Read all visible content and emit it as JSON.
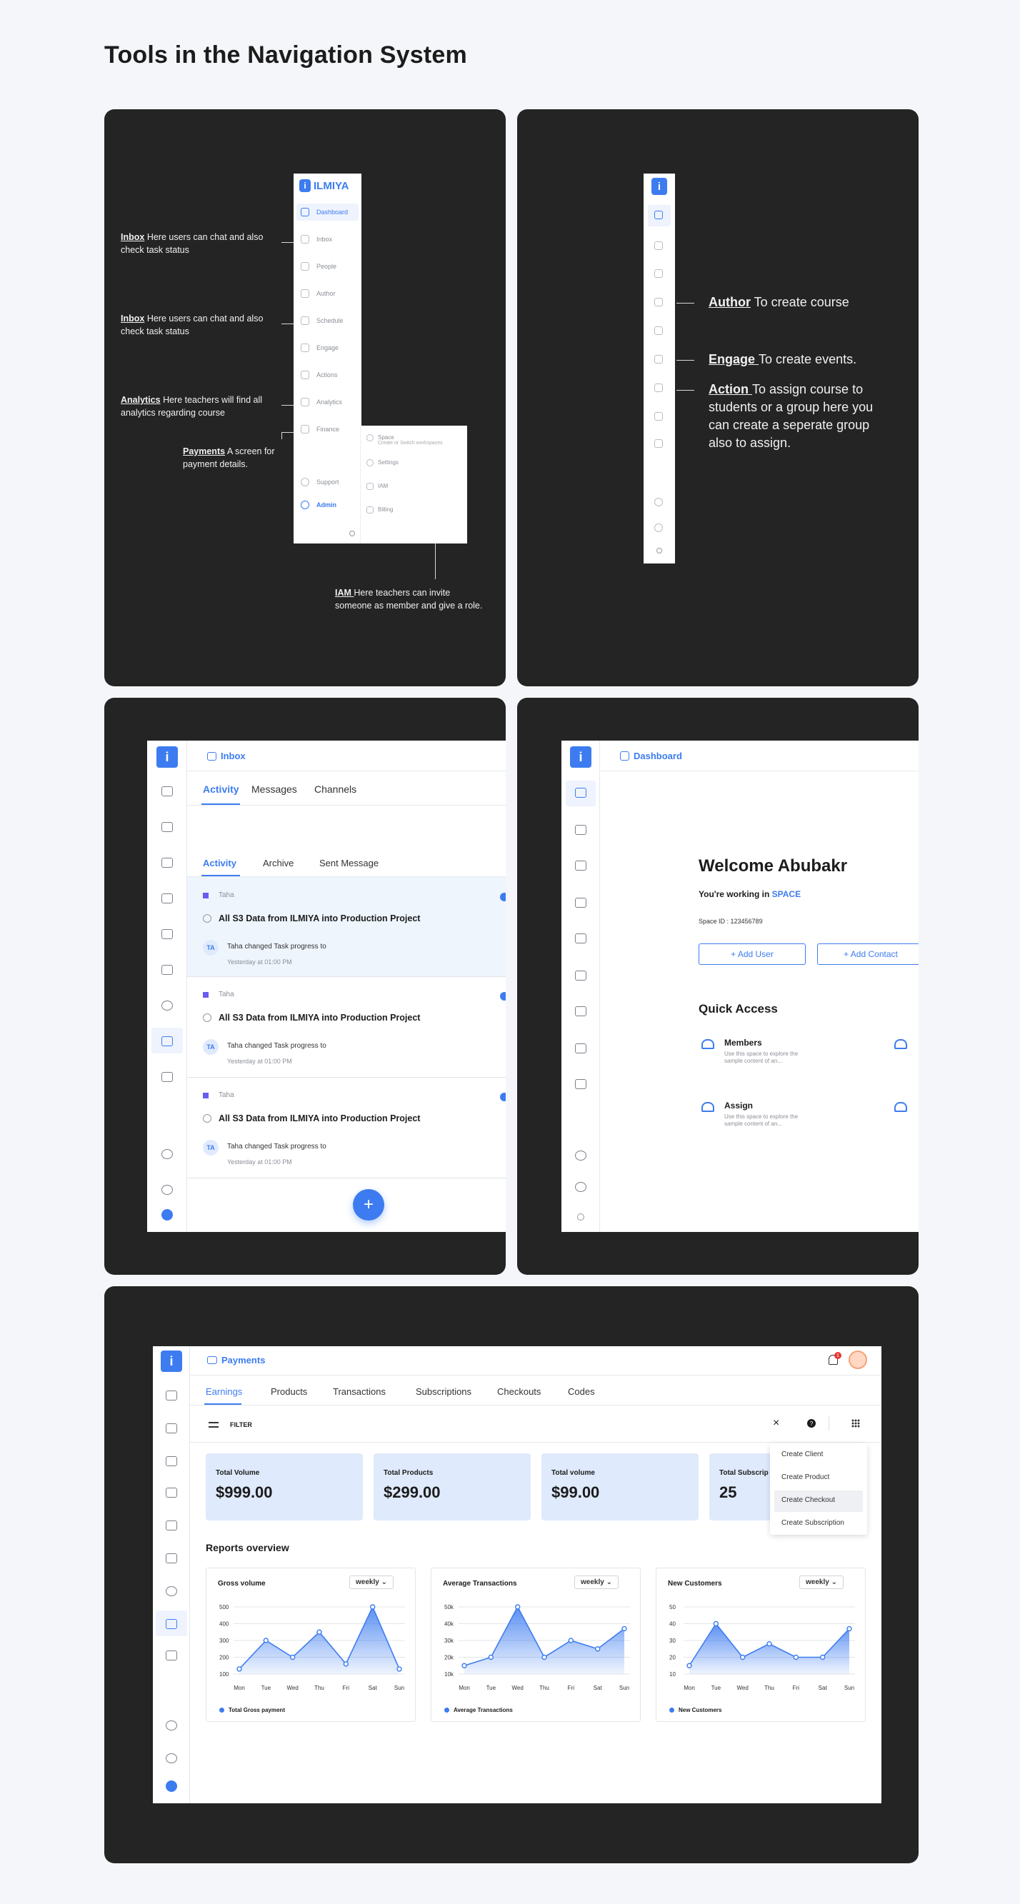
{
  "page": {
    "title": "Tools in the Navigation System"
  },
  "panel1": {
    "logo_text": "ILMIYA",
    "logo_letter": "i",
    "menu": [
      "Dashboard",
      "Inbox",
      "People",
      "Author",
      "Schedule",
      "Engage",
      "Actions",
      "Analytics",
      "Finance",
      "Support",
      "Admin"
    ],
    "submenu": [
      {
        "label": "Space",
        "sub": "Create or Switch workspaces"
      },
      {
        "label": "Settings",
        "sub": ""
      },
      {
        "label": "IAM",
        "sub": ""
      },
      {
        "label": "Billing",
        "sub": ""
      }
    ],
    "annotations": [
      {
        "key": "Inbox",
        "text": " Here users can chat and also check task status"
      },
      {
        "key": "Inbox",
        "text": " Here users can chat and also check task status"
      },
      {
        "key": "Analytics",
        "text": " Here teachers will find all analytics regarding course"
      },
      {
        "key": "Payments",
        "text": " A screen for payment details."
      },
      {
        "key": "IAM ",
        "text": " Here teachers can invite someone as member and give a role."
      }
    ]
  },
  "panel2": {
    "annotations": [
      {
        "key": "Author",
        "text": " To create course"
      },
      {
        "key": "Engage ",
        "text": "To create events."
      },
      {
        "key": "Action ",
        "text": "To assign course to students or a group here you can create a seperate group also to assign."
      }
    ]
  },
  "inbox": {
    "header": "Inbox",
    "tabs": [
      "Activity",
      "Messages",
      "Channels"
    ],
    "subtabs": [
      "Activity",
      "Archive",
      "Sent Message"
    ],
    "items": [
      {
        "author": "Taha",
        "title": "All S3 Data from ILMIYA into Production Project",
        "initials": "TA",
        "change": "Taha changed Task progress to",
        "time": "Yesterday at 01:00 PM"
      },
      {
        "author": "Taha",
        "title": "All S3 Data from ILMIYA into Production Project",
        "initials": "TA",
        "change": "Taha changed Task progress to",
        "time": "Yesterday at 01:00 PM"
      },
      {
        "author": "Taha",
        "title": "All S3 Data from ILMIYA into Production Project",
        "initials": "TA",
        "change": "Taha changed Task progress to",
        "time": "Yesterday at 01:00 PM"
      }
    ],
    "fab": "+"
  },
  "dashboard": {
    "header": "Dashboard",
    "welcome": "Welcome Abubakr",
    "working_prefix": "You're working in ",
    "space": "SPACE",
    "space_id": "Space ID : 123456789",
    "add_user": "+ Add User",
    "add_contact": "+ Add Contact",
    "quick_access": "Quick Access",
    "qa_items": [
      {
        "title": "Members",
        "desc": "Use this space to explore the sample content of an..."
      },
      {
        "title": "Assign",
        "desc": "Use this space to explore the sample content of an..."
      }
    ]
  },
  "payments": {
    "header": "Payments",
    "notif_count": "1",
    "tabs": [
      "Earnings",
      "Products",
      "Transactions",
      "Subscriptions",
      "Checkouts",
      "Codes"
    ],
    "filter": "FILTER",
    "close": "×",
    "help": "?",
    "menu": [
      "Create Client",
      "Create Product",
      "Create Checkout",
      "Create Subscription"
    ],
    "stats": [
      {
        "label": "Total Volume",
        "value": "$999.00"
      },
      {
        "label": "Total Products",
        "value": "$299.00"
      },
      {
        "label": "Total volume",
        "value": "$99.00"
      },
      {
        "label": "Total Subscrip",
        "value": "25"
      }
    ],
    "reports_title": "Reports overview",
    "period": "weekly"
  },
  "chart_data": [
    {
      "type": "area",
      "title": "Gross volume",
      "categories": [
        "Mon",
        "Tue",
        "Wed",
        "Thu",
        "Fri",
        "Sat",
        "Sun"
      ],
      "yticks": [
        "500",
        "400",
        "300",
        "200",
        "100"
      ],
      "ylim": [
        100,
        500
      ],
      "series": [
        {
          "name": "Total Gross payment",
          "values": [
            130,
            300,
            200,
            350,
            160,
            500,
            130
          ]
        }
      ],
      "color": "#3d7cf0"
    },
    {
      "type": "area",
      "title": "Average Transactions",
      "categories": [
        "Mon",
        "Tue",
        "Wed",
        "Thu",
        "Fri",
        "Sat",
        "Sun"
      ],
      "yticks": [
        "50k",
        "40k",
        "30k",
        "20k",
        "10k"
      ],
      "ylim": [
        10,
        50
      ],
      "series": [
        {
          "name": "Average Transactions",
          "values": [
            15,
            20,
            50,
            20,
            30,
            25,
            37
          ]
        }
      ],
      "color": "#3d7cf0"
    },
    {
      "type": "area",
      "title": "New Customers",
      "categories": [
        "Mon",
        "Tue",
        "Wed",
        "Thu",
        "Fri",
        "Sat",
        "Sun"
      ],
      "yticks": [
        "50",
        "40",
        "30",
        "20",
        "10"
      ],
      "ylim": [
        10,
        50
      ],
      "series": [
        {
          "name": "New Customers",
          "values": [
            15,
            40,
            20,
            28,
            20,
            20,
            37
          ]
        }
      ],
      "color": "#3d7cf0"
    }
  ]
}
